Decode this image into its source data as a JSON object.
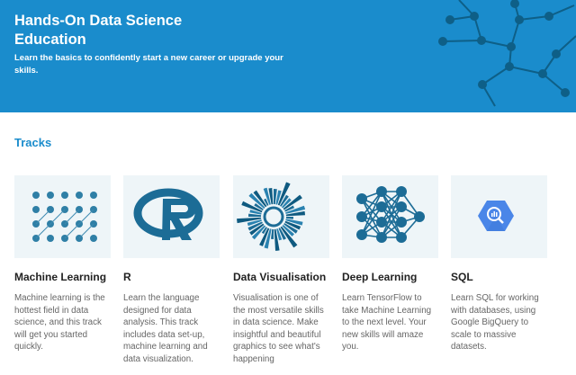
{
  "hero": {
    "title": "Hands-On Data Science Education",
    "subtitle": "Learn the basics to confidently start a new career or upgrade your skills."
  },
  "section_title": "Tracks",
  "tracks": [
    {
      "title": "Machine Learning",
      "description": "Machine learning is the hottest field in data science, and this track will get you started quickly.",
      "icon": "machine-learning-dots-icon"
    },
    {
      "title": "R",
      "description": "Learn the language designed for data analysis. This track includes data set-up, machine learning and data visualization.",
      "icon": "r-logo-icon"
    },
    {
      "title": "Data Visualisation",
      "description": "Visualisation is one of the most versatile skills in data science. Make insightful and beautiful graphics to see what's happening",
      "icon": "radial-chart-icon"
    },
    {
      "title": "Deep Learning",
      "description": "Learn TensorFlow to take Machine Learning to the next level. Your new skills will amaze you.",
      "icon": "neural-network-icon"
    },
    {
      "title": "SQL",
      "description": "Learn SQL for working with databases, using Google BigQuery to scale to massive datasets.",
      "icon": "bigquery-icon"
    }
  ],
  "colors": {
    "brand": "#1a8ccc",
    "dark": "#0f5f85",
    "card_bg": "#eef5f8"
  }
}
